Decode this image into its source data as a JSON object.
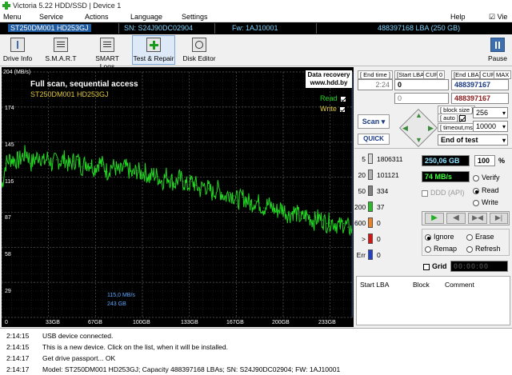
{
  "title": "Victoria 5.22 HDD/SSD | Device 1",
  "menu": {
    "items": [
      "Menu",
      "Service",
      "Actions",
      "Language",
      "Settings"
    ],
    "help": "Help",
    "view": "Vie"
  },
  "device": {
    "model": "ST250DM001 HD253GJ",
    "sn": "SN: S24J90DC02904",
    "fw": "Fw: 1AJ10001",
    "capacity": "488397168 LBA (250 GB)"
  },
  "toolbar": {
    "drive_info": "Drive Info",
    "smart": "S.M.A.R.T",
    "smart_logs": "SMART Logs",
    "test_repair": "Test & Repair",
    "disk_editor": "Disk Editor",
    "pause": "Pause"
  },
  "graph": {
    "title": "Full scan, sequential access",
    "model": "ST250DM001 HD253GJ",
    "recovery_line1": "Data recovery",
    "recovery_line2": "www.hdd.by",
    "read_label": "Read",
    "write_label": "Write",
    "y_ticks": [
      "204 (MB/s)",
      "174",
      "145",
      "116",
      "87",
      "58",
      "29"
    ],
    "x_ticks": [
      "0",
      "33GB",
      "67GB",
      "100GB",
      "133GB",
      "167GB",
      "200GB",
      "233GB"
    ],
    "cursor_speed": "115,0 MB/s",
    "cursor_pos": "243 GB",
    "line_color": "#22d522"
  },
  "chart_data": {
    "type": "line",
    "xlabel": "",
    "ylabel": "MB/s",
    "xlim": [
      0,
      250
    ],
    "ylim": [
      0,
      204
    ],
    "x": [
      0,
      3,
      6,
      9,
      12,
      15,
      18,
      21,
      24,
      27,
      30,
      33,
      36,
      39,
      42,
      45,
      48,
      51,
      54,
      57,
      60,
      63,
      66,
      69,
      72,
      75,
      78,
      81,
      84,
      87,
      90,
      93,
      96,
      99,
      102,
      105,
      108,
      111,
      114,
      117,
      120,
      123,
      126,
      129,
      132,
      135,
      138,
      141,
      144,
      147,
      150,
      153,
      156,
      159,
      162,
      165,
      168,
      171,
      174,
      177,
      180,
      183,
      186,
      189,
      192,
      195,
      198,
      201,
      204,
      207,
      210,
      213,
      216,
      219,
      222,
      225,
      228,
      231,
      234,
      237,
      240,
      243,
      246,
      249
    ],
    "series": [
      {
        "name": "Read",
        "values": [
          108,
          128,
          132,
          131,
          130,
          134,
          137,
          128,
          132,
          135,
          129,
          133,
          127,
          131,
          130,
          132,
          126,
          130,
          131,
          125,
          129,
          128,
          124,
          129,
          127,
          121,
          126,
          124,
          120,
          125,
          123,
          118,
          122,
          120,
          121,
          116,
          119,
          117,
          113,
          118,
          115,
          111,
          116,
          113,
          109,
          113,
          110,
          106,
          110,
          107,
          103,
          107,
          104,
          100,
          104,
          101,
          97,
          100,
          98,
          94,
          97,
          95,
          91,
          94,
          92,
          88,
          91,
          89,
          85,
          88,
          86,
          82,
          85,
          83,
          80,
          83,
          81,
          78,
          80,
          78,
          76,
          78,
          75,
          73
        ]
      }
    ]
  },
  "right": {
    "end_time_label": "[ End time ]",
    "time_value": "2:24",
    "start_lba_label": "[Start LBA]",
    "cur_label": "CUR",
    "zero_label": "0",
    "end_lba_label": "[End LBA]",
    "max_label": "MAX",
    "start_lba_value": "0",
    "end_lba_value": "488397167",
    "start_lba_value2": "0",
    "current_lba_value": "488397167",
    "scan_button": "Scan",
    "quick_button": "QUICK",
    "block_size_label": "[ block size ]",
    "auto_label": "[ auto ]",
    "timeout_label": "[ timeout,ms ]",
    "block_size_value": "256",
    "timeout_value": "10000",
    "end_action": "End of test",
    "gb_value": "250,06 GB",
    "percent_value": "100",
    "percent_sign": "%",
    "speed_value": "74 MB/s",
    "ddd_label": "DDD (API)",
    "verify_label": "Verify",
    "read_label": "Read",
    "write_label": "Write",
    "ignore_label": "Ignore",
    "erase_label": "Erase",
    "remap_label": "Remap",
    "refresh_label": "Refresh",
    "grid_label": "Grid",
    "timer_value": "00:00:00",
    "blocks": [
      {
        "label": "5",
        "count": "1806311",
        "color": "#d8d8d8"
      },
      {
        "label": "20",
        "count": "101121",
        "color": "#b0b0b0"
      },
      {
        "label": "50",
        "count": "334",
        "color": "#808080"
      },
      {
        "label": "200",
        "count": "37",
        "color": "#22c022"
      },
      {
        "label": "600",
        "count": "0",
        "color": "#f08020"
      },
      {
        "label": ">",
        "count": "0",
        "color": "#e01010"
      },
      {
        "label": "Err",
        "count": "0",
        "color": "#2040d0"
      }
    ],
    "lba_cols": [
      "Start LBA",
      "Block",
      "Comment"
    ]
  },
  "log": [
    {
      "time": "2:14:15",
      "text": "USB device connected."
    },
    {
      "time": "2:14:15",
      "text": "This is a new device. Click on the list, when it will be installed."
    },
    {
      "time": "2:14:17",
      "text": "Get drive passport... OK"
    },
    {
      "time": "2:14:17",
      "text": "Model: ST250DM001 HD253GJ; Capacity 488397168 LBAs; SN: S24J90DC02904; FW: 1AJ10001"
    }
  ]
}
